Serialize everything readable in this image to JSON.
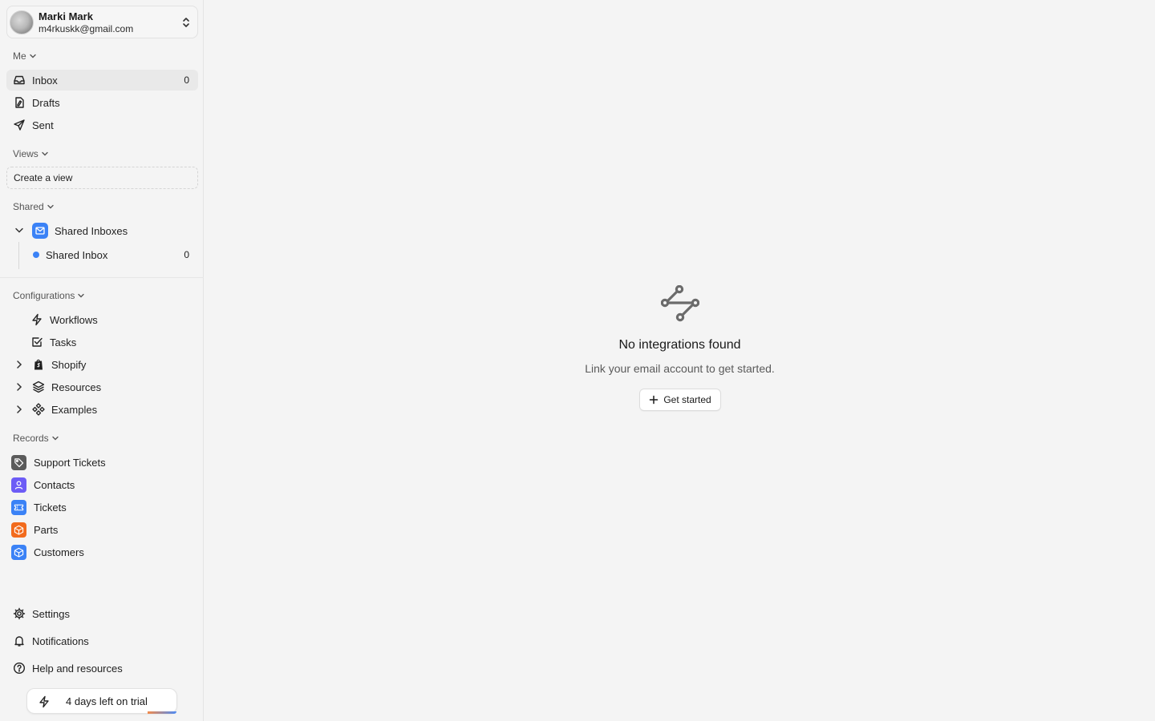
{
  "account": {
    "name": "Marki Mark",
    "email": "m4rkuskk@gmail.com"
  },
  "sections": {
    "me": "Me",
    "views": "Views",
    "shared": "Shared",
    "configurations": "Configurations",
    "records": "Records"
  },
  "me_items": [
    {
      "label": "Inbox",
      "count": "0",
      "icon": "inbox-icon"
    },
    {
      "label": "Drafts",
      "icon": "draft-icon"
    },
    {
      "label": "Sent",
      "icon": "send-icon"
    }
  ],
  "views": {
    "create_label": "Create a view"
  },
  "shared": {
    "group_label": "Shared Inboxes",
    "inbox_label": "Shared Inbox",
    "inbox_count": "0",
    "inbox_dot_color": "#3b82f6"
  },
  "configurations": [
    {
      "label": "Workflows",
      "icon": "zap-icon"
    },
    {
      "label": "Tasks",
      "icon": "task-check-icon"
    },
    {
      "label": "Shopify",
      "icon": "shopify-icon"
    },
    {
      "label": "Resources",
      "icon": "layers-icon"
    },
    {
      "label": "Examples",
      "icon": "components-icon"
    }
  ],
  "records": [
    {
      "label": "Support Tickets",
      "color": "#5b5b5b",
      "icon": "tag-icon"
    },
    {
      "label": "Contacts",
      "color": "#6d5cf6",
      "icon": "person-icon"
    },
    {
      "label": "Tickets",
      "color": "#3b82f6",
      "icon": "ticket-icon"
    },
    {
      "label": "Parts",
      "color": "#f26b1d",
      "icon": "box-icon"
    },
    {
      "label": "Customers",
      "color": "#3b82f6",
      "icon": "cube-icon"
    }
  ],
  "footer": {
    "settings": "Settings",
    "notifications": "Notifications",
    "help": "Help and resources",
    "trial": "4 days left on trial"
  },
  "empty_state": {
    "title": "No integrations found",
    "subtitle": "Link your email account to get started.",
    "button": "Get started",
    "icon": "integration-route-icon"
  }
}
